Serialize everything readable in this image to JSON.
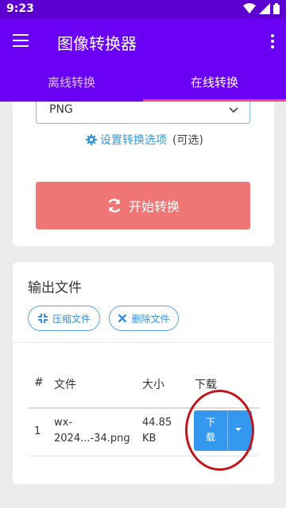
{
  "statusbar": {
    "time": "9:23"
  },
  "appbar": {
    "title": "图像转换器"
  },
  "tabs": [
    {
      "label": "离线转换",
      "active": false
    },
    {
      "label": "在线转换",
      "active": true
    }
  ],
  "converter": {
    "format_select": "PNG",
    "options_link": "设置转换选项",
    "options_note": "(可选)",
    "convert_label": "开始转换"
  },
  "output": {
    "heading": "输出文件",
    "compress_label": "压缩文件",
    "delete_label": "删除文件",
    "columns": [
      "#",
      "文件",
      "大小",
      "下载"
    ],
    "rows": [
      {
        "index": "1",
        "file_line1": "wx-",
        "file_line2": "2024...-34.png",
        "size_line1": "44.85",
        "size_line2": "KB",
        "download_label": "下载"
      }
    ]
  },
  "colors": {
    "appbar": "#6a00f4",
    "statusbar": "#5c00d1",
    "tab_indicator": "#ff4081",
    "convert_button": "#f07575",
    "link": "#3498db",
    "download_button": "#3498f0",
    "annotation": "#c2161c"
  }
}
